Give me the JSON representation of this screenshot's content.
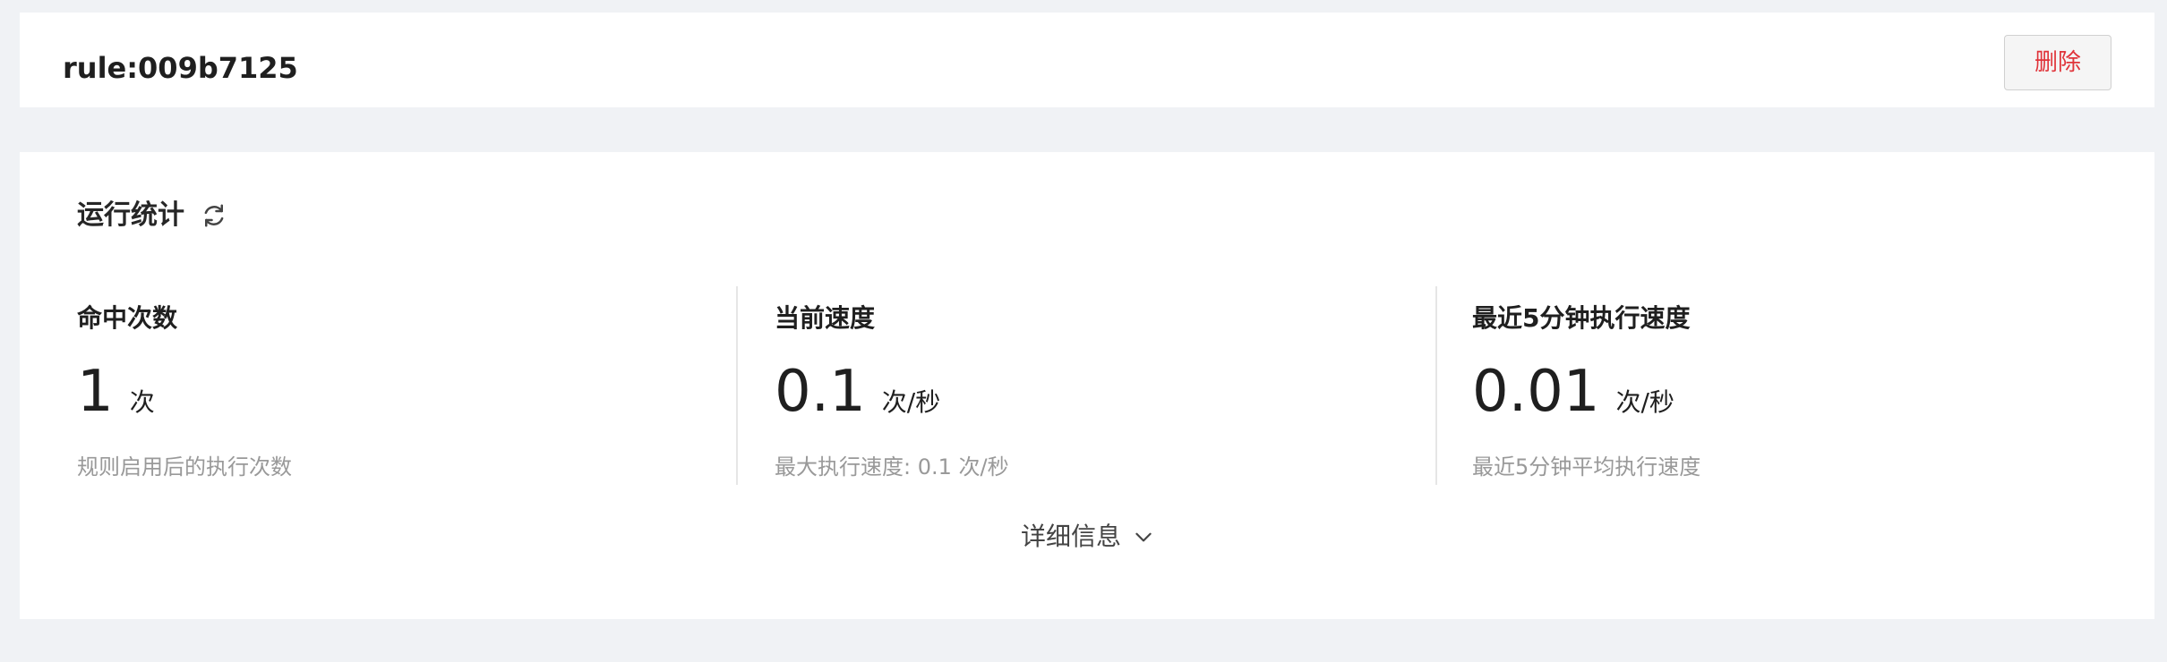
{
  "header": {
    "rule_title": "rule:009b7125",
    "delete_label": "删除"
  },
  "stats": {
    "section_title": "运行统计",
    "refresh_icon": "refresh-icon",
    "items": [
      {
        "label": "命中次数",
        "value": "1",
        "unit": "次",
        "description": "规则启用后的执行次数"
      },
      {
        "label": "当前速度",
        "value": "0.1",
        "unit": "次/秒",
        "description": "最大执行速度: 0.1 次/秒"
      },
      {
        "label": "最近5分钟执行速度",
        "value": "0.01",
        "unit": "次/秒",
        "description": "最近5分钟平均执行速度"
      }
    ],
    "details_label": "详细信息",
    "details_icon": "chevron-down-icon"
  },
  "colors": {
    "page_background": "#f0f2f5",
    "card_background": "#ffffff",
    "danger": "#e0343a",
    "muted_text": "#999999"
  }
}
